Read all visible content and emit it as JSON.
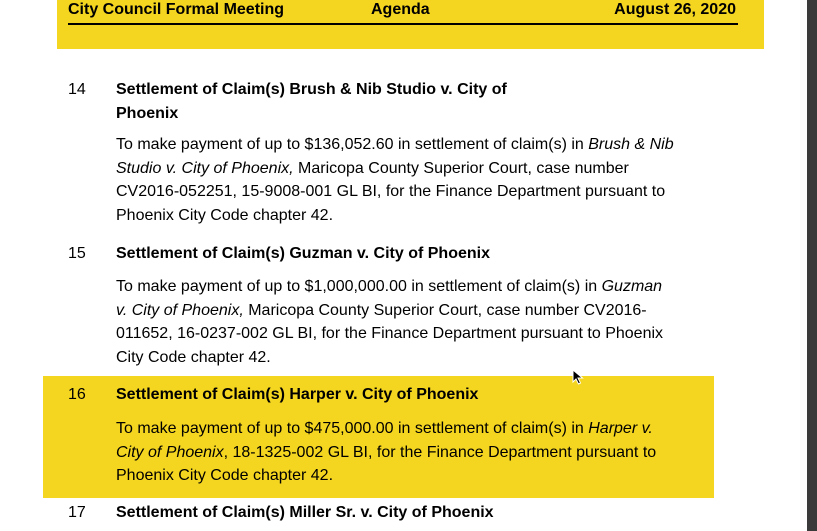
{
  "header": {
    "left": "City Council Formal Meeting",
    "center": "Agenda",
    "right": "August 26, 2020"
  },
  "items": [
    {
      "number": "14",
      "title": "Settlement of Claim(s) Brush & Nib Studio v. City of Phoenix",
      "body": {
        "pre": "To make payment of up to $136,052.60 in settlement of claim(s) in ",
        "case": "Brush & Nib Studio v. City of Phoenix,",
        "post": " Maricopa County Superior Court, case number CV2016-052251, 15-9008-001 GL BI, for the Finance Department pursuant to Phoenix City Code chapter 42."
      }
    },
    {
      "number": "15",
      "title": "Settlement of Claim(s) Guzman v. City of Phoenix",
      "body": {
        "pre": "To make payment of up to $1,000,000.00 in settlement of claim(s) in ",
        "case": "Guzman v. City of Phoenix,",
        "post": " Maricopa County Superior Court, case number CV2016-011652, 16-0237-002 GL BI, for the Finance Department pursuant to Phoenix City Code chapter 42."
      }
    },
    {
      "number": "16",
      "title": "Settlement of Claim(s) Harper v. City of Phoenix",
      "body": {
        "pre": "To make payment of up to $475,000.00 in settlement of claim(s) in ",
        "case": "Harper v. City of Phoenix",
        "post": ", 18-1325-002 GL BI, for the Finance Department pursuant to Phoenix City Code chapter 42."
      }
    },
    {
      "number": "17",
      "title": "Settlement of Claim(s) Miller Sr. v. City of Phoenix"
    }
  ],
  "colors": {
    "highlight": "#f4d51f",
    "text": "#000000"
  }
}
